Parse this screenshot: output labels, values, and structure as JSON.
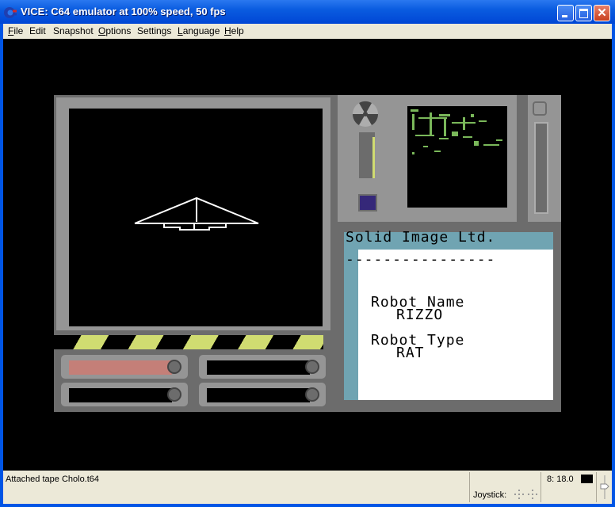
{
  "window": {
    "title": "VICE: C64 emulator at 100% speed, 50 fps",
    "icons": {
      "app": "commodore-logo-icon",
      "minimize": "minimize-icon",
      "maximize": "maximize-icon",
      "close": "close-icon"
    },
    "close_glyph": "✕"
  },
  "menu": [
    {
      "label": "File",
      "accel": "F",
      "rest": "ile"
    },
    {
      "label": "Edit",
      "accel": "",
      "rest": "Edit"
    },
    {
      "label": "Snapshot",
      "accel": "",
      "rest": "Snapshot"
    },
    {
      "label": "Options",
      "accel": "O",
      "rest": "ptions"
    },
    {
      "label": "Settings",
      "accel": "",
      "rest": "Settings"
    },
    {
      "label": "Language",
      "accel": "L",
      "rest": "anguage"
    },
    {
      "label": "Help",
      "accel": "H",
      "rest": "elp"
    }
  ],
  "game": {
    "info_panel": {
      "header": "Solid Image Ltd.",
      "divider": "----------------",
      "robot_name_label": "Robot Name",
      "robot_name_value": "RIZZO",
      "robot_type_label": "Robot Type",
      "robot_type_value": "RAT"
    },
    "colors": {
      "frame_light": "#959595",
      "frame_dark": "#6c6c6c",
      "hazard_yellow": "#d0dc71",
      "info_cyan": "#70a4b2",
      "indicator_blue": "#352879",
      "energy_red": "#c47f78",
      "map_green": "#7ab85a"
    },
    "slots": [
      {
        "name": "slot-top-left",
        "fill_color": "#c47f78",
        "filled": true
      },
      {
        "name": "slot-top-right",
        "fill_color": "#000000",
        "filled": false
      },
      {
        "name": "slot-bottom-left",
        "fill_color": "#000000",
        "filled": false
      },
      {
        "name": "slot-bottom-right",
        "fill_color": "#000000",
        "filled": false
      }
    ],
    "left_gauge_level": 0.9,
    "icons": {
      "radiation": "radiation-icon",
      "skull": "skull-icon"
    }
  },
  "status": {
    "message": "Attached tape Cholo.t64",
    "joystick_label": "Joystick:",
    "drive_status": "8: 18.0"
  }
}
